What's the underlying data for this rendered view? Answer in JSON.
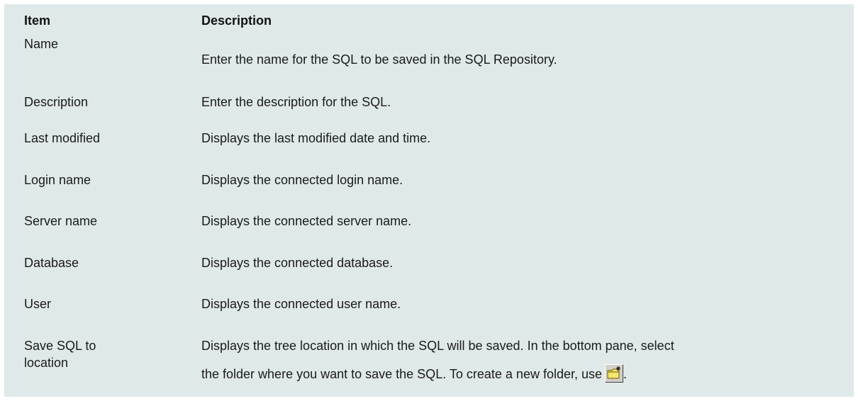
{
  "colors": {
    "background": "#e0e9e9",
    "text": "#1a1a1a"
  },
  "table": {
    "headers": {
      "item": "Item",
      "description": "Description"
    },
    "rows": [
      {
        "item": "Name",
        "description": "Enter the name for the SQL to be saved in the SQL Repository."
      },
      {
        "item": "Description",
        "description": "Enter the description for the SQL."
      },
      {
        "item": "Last modified",
        "description": "Displays the last modified date and time."
      },
      {
        "item": "Login name",
        "description": "Displays the connected login name."
      },
      {
        "item": "Server name",
        "description": "Displays the connected server name."
      },
      {
        "item": "Database",
        "description": "Displays the connected database."
      },
      {
        "item": "User",
        "description": "Displays the connected user name."
      },
      {
        "item_line1": "Save SQL to",
        "item_line2": "location",
        "description_line1": "Displays the tree location in which the SQL will be saved. In the bottom pane, select",
        "description_line2": "the folder where you want to save the SQL. To create a new folder, use",
        "description_end": ".",
        "icon": "new-folder-icon"
      }
    ]
  }
}
